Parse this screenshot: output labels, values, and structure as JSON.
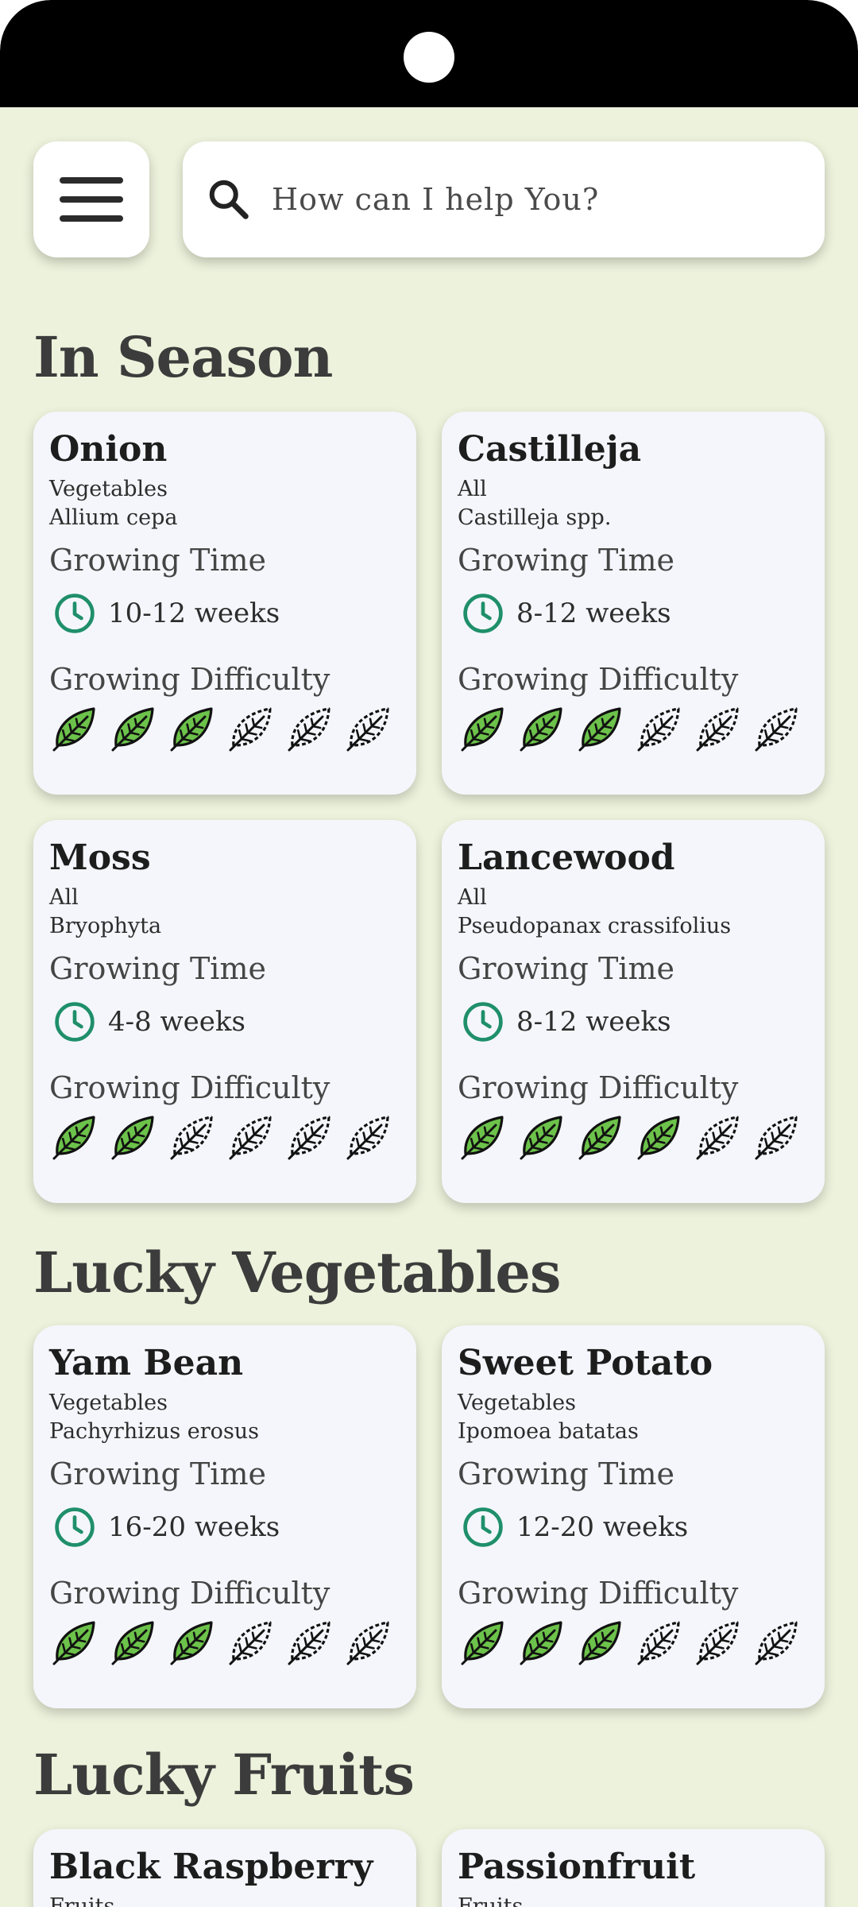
{
  "search": {
    "placeholder": "How can I help You?"
  },
  "sections": [
    {
      "title": "In Season",
      "cards": [
        {
          "name": "Onion",
          "category": "Vegetables",
          "scientific": "Allium cepa",
          "time_label": "Growing Time",
          "time": "10-12 weeks",
          "difficulty_label": "Growing Difficulty",
          "difficulty": 3
        },
        {
          "name": "Castilleja",
          "category": "All",
          "scientific": "Castilleja spp.",
          "time_label": "Growing Time",
          "time": "8-12 weeks",
          "difficulty_label": "Growing Difficulty",
          "difficulty": 3
        },
        {
          "name": "Moss",
          "category": "All",
          "scientific": "Bryophyta",
          "time_label": "Growing Time",
          "time": "4-8 weeks",
          "difficulty_label": "Growing Difficulty",
          "difficulty": 2
        },
        {
          "name": "Lancewood",
          "category": "All",
          "scientific": "Pseudopanax crassifolius",
          "time_label": "Growing Time",
          "time": "8-12 weeks",
          "difficulty_label": "Growing Difficulty",
          "difficulty": 4
        }
      ]
    },
    {
      "title": "Lucky Vegetables",
      "cards": [
        {
          "name": "Yam Bean",
          "category": "Vegetables",
          "scientific": "Pachyrhizus erosus",
          "time_label": "Growing Time",
          "time": "16-20 weeks",
          "difficulty_label": "Growing Difficulty",
          "difficulty": 3
        },
        {
          "name": "Sweet Potato",
          "category": "Vegetables",
          "scientific": "Ipomoea batatas",
          "time_label": "Growing Time",
          "time": "12-20 weeks",
          "difficulty_label": "Growing Difficulty",
          "difficulty": 3
        }
      ]
    },
    {
      "title": "Lucky Fruits",
      "cards": [
        {
          "name": "Black Raspberry",
          "category": "Fruits"
        },
        {
          "name": "Passionfruit",
          "category": "Fruits"
        }
      ]
    }
  ],
  "difficulty_scale_max": 6,
  "colors": {
    "background": "#edf2dc",
    "card": "#f4f6fb",
    "leaf_filled": "#6cc24a",
    "clock": "#1f8f6a"
  },
  "icons": {
    "menu": "hamburger-menu-icon",
    "search": "search-icon",
    "time": "clock-icon",
    "difficulty": "leaf-icon"
  }
}
